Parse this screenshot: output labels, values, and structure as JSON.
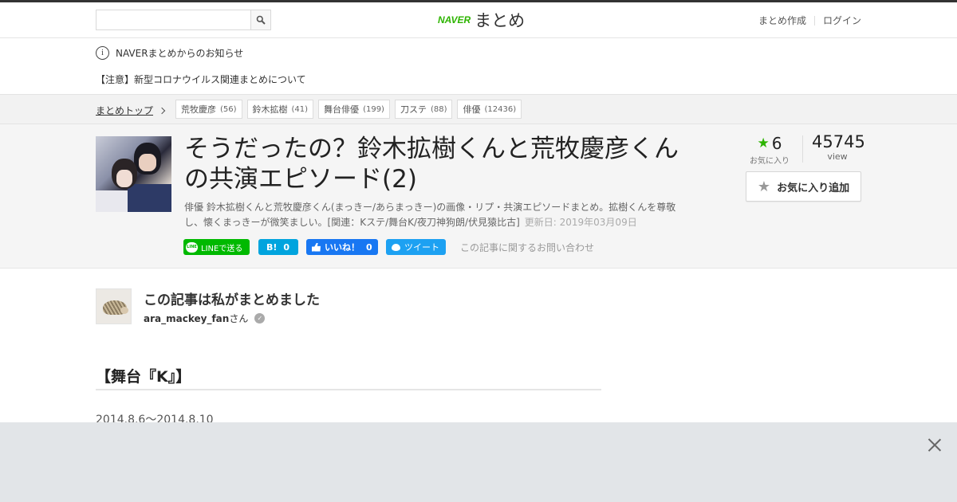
{
  "header": {
    "search_placeholder": "",
    "logo_naver": "NAVER",
    "logo_matome": "まとめ",
    "link_create": "まとめ作成",
    "link_login": "ログイン"
  },
  "notice": {
    "info_symbol": "i",
    "title": "NAVERまとめからのお知らせ",
    "item": "【注意】新型コロナウイルス関連まとめについて"
  },
  "tagbar": {
    "breadcrumb": "まとめトップ",
    "tags": [
      {
        "label": "荒牧慶彦",
        "count": "(56)"
      },
      {
        "label": "鈴木拡樹",
        "count": "(41)"
      },
      {
        "label": "舞台俳優",
        "count": "(199)"
      },
      {
        "label": "刀ステ",
        "count": "(88)"
      },
      {
        "label": "俳優",
        "count": "(12436)"
      }
    ]
  },
  "article": {
    "title": "そうだったの？鈴木拡樹くんと荒牧慶彦くんの共演エピソード(2)",
    "description": "俳優 鈴木拡樹くんと荒牧慶彦くん(まっきー/あらまっきー)の画像・リプ・共演エピソードまとめ。拡樹くんを尊敬し、懐くまっきーが微笑ましい。[関連：Kステ/舞台K/夜刀神狗朗/伏見猿比古]",
    "updated": "更新日: 2019年03月09日",
    "favorites_count": "6",
    "favorites_label": "お気に入り",
    "views_count": "45745",
    "views_label": "view",
    "fav_button": "お気に入り追加",
    "star_symbol": "★",
    "share": {
      "line_label": "LINEで送る",
      "line_bubble": "LINE",
      "hatena_label": "B!",
      "hatena_count": "0",
      "fb_label": "いいね！",
      "fb_count": "0",
      "tweet_label": "ツイート"
    },
    "inquiry": "この記事に関するお問い合わせ"
  },
  "author": {
    "heading": "この記事は私がまとめました",
    "name": "ara_mackey_fan",
    "suffix": "さん",
    "verified_symbol": "✓"
  },
  "content": {
    "section_heading": "【舞台『K』】",
    "date_line": "2014.8.6～2014.8.10"
  },
  "colors": {
    "naver_green": "#2db400",
    "line_green": "#00b900",
    "hatena_blue": "#00a4de",
    "facebook_blue": "#1877f2",
    "twitter_blue": "#1da1f2"
  }
}
